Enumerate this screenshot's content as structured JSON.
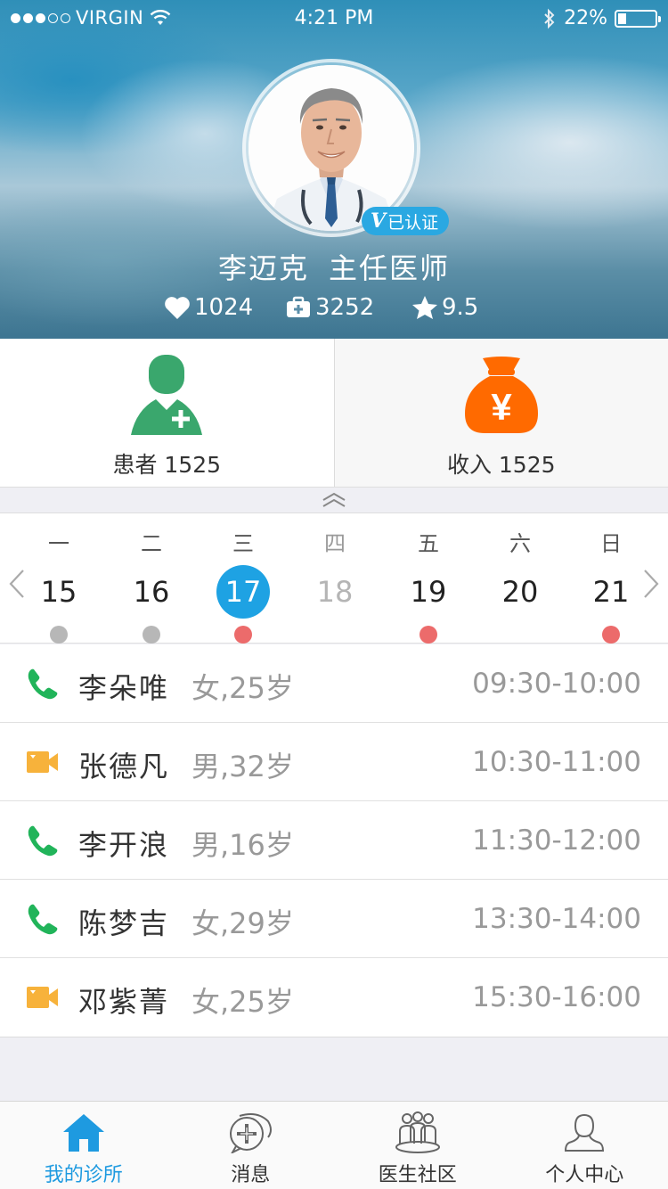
{
  "status_bar": {
    "carrier": "VIRGIN",
    "time": "4:21 PM",
    "battery": "22%",
    "battery_level": 0.22
  },
  "profile": {
    "verified_mark": "V",
    "verified_label": "已认证",
    "name": "李迈克",
    "title": "主任医师",
    "stats": {
      "likes": "1024",
      "consults": "3252",
      "rating": "9.5"
    }
  },
  "tiles": {
    "patients_label": "患者 1525",
    "income_label": "收入 1525",
    "income_symbol": "¥"
  },
  "calendar": {
    "days": [
      {
        "weekday": "一",
        "date": "15",
        "dot": "gray",
        "state": "normal"
      },
      {
        "weekday": "二",
        "date": "16",
        "dot": "gray",
        "state": "normal"
      },
      {
        "weekday": "三",
        "date": "17",
        "dot": "red",
        "state": "active"
      },
      {
        "weekday": "四",
        "date": "18",
        "dot": "none",
        "state": "muted"
      },
      {
        "weekday": "五",
        "date": "19",
        "dot": "red",
        "state": "normal"
      },
      {
        "weekday": "六",
        "date": "20",
        "dot": "none",
        "state": "normal"
      },
      {
        "weekday": "日",
        "date": "21",
        "dot": "red",
        "state": "normal"
      }
    ]
  },
  "appointments": [
    {
      "type": "phone",
      "name": "李朵唯",
      "info": "女,25岁",
      "time": "09:30-10:00"
    },
    {
      "type": "video",
      "name": "张德凡",
      "info": "男,32岁",
      "time": "10:30-11:00"
    },
    {
      "type": "phone",
      "name": "李开浪",
      "info": "男,16岁",
      "time": "11:30-12:00"
    },
    {
      "type": "phone",
      "name": "陈梦吉",
      "info": "女,29岁",
      "time": "13:30-14:00"
    },
    {
      "type": "video",
      "name": "邓紫菁",
      "info": "女,25岁",
      "time": "15:30-16:00"
    }
  ],
  "tabbar": {
    "items": [
      {
        "label": "我的诊所",
        "icon": "home-icon",
        "active": true
      },
      {
        "label": "消息",
        "icon": "message-icon",
        "active": false
      },
      {
        "label": "医生社区",
        "icon": "community-icon",
        "active": false
      },
      {
        "label": "个人中心",
        "icon": "person-icon",
        "active": false
      }
    ]
  },
  "colors": {
    "accent": "#1ea2e3",
    "patient_green": "#3aa76d",
    "income_orange": "#ff6a00",
    "phone_green": "#21b45a",
    "video_orange": "#f7b23b",
    "dot_red": "#ec6b6b",
    "dot_gray": "#b7b7b7"
  }
}
